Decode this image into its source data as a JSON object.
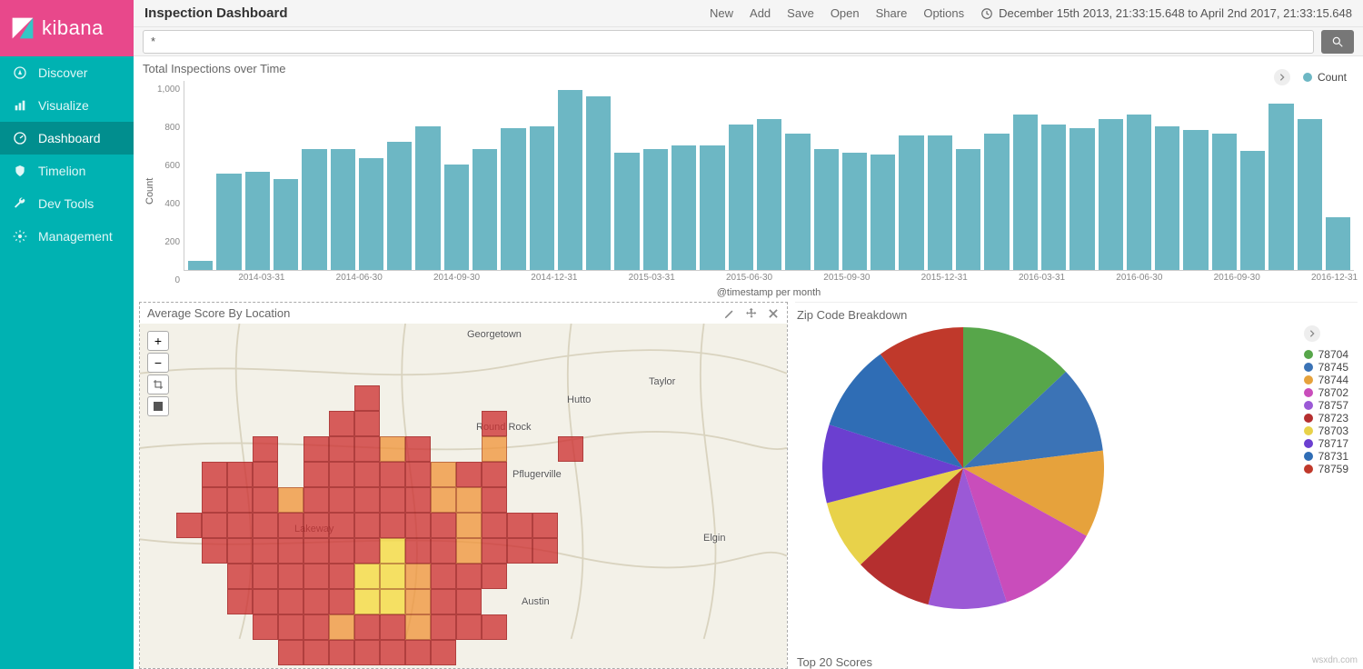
{
  "brand": "kibana",
  "sidebar": {
    "items": [
      {
        "label": "Discover"
      },
      {
        "label": "Visualize"
      },
      {
        "label": "Dashboard"
      },
      {
        "label": "Timelion"
      },
      {
        "label": "Dev Tools"
      },
      {
        "label": "Management"
      }
    ]
  },
  "topbar": {
    "title": "Inspection Dashboard",
    "links": [
      "New",
      "Add",
      "Save",
      "Open",
      "Share",
      "Options"
    ],
    "timerange": "December 15th 2013, 21:33:15.648 to April 2nd 2017, 21:33:15.648"
  },
  "search": {
    "value": "*"
  },
  "barpanel": {
    "title": "Total Inspections over Time",
    "ylabel": "Count",
    "xlabel": "@timestamp per month",
    "legend": "Count",
    "legend_color": "#6db7c4",
    "yticks": [
      "1,000",
      "800",
      "600",
      "400",
      "200",
      "0"
    ],
    "xticks": [
      "2014-03-31",
      "2014-06-30",
      "2014-09-30",
      "2014-12-31",
      "2015-03-31",
      "2015-06-30",
      "2015-09-30",
      "2015-12-31",
      "2016-03-31",
      "2016-06-30",
      "2016-09-30",
      "2016-12-31"
    ]
  },
  "chart_data": [
    {
      "id": "bar-total-inspections",
      "type": "bar",
      "title": "Total Inspections over Time",
      "xlabel": "@timestamp per month",
      "ylabel": "Count",
      "ylim": [
        0,
        1000
      ],
      "categories": [
        "2014-01",
        "2014-02",
        "2014-03",
        "2014-04",
        "2014-05",
        "2014-06",
        "2014-07",
        "2014-08",
        "2014-09",
        "2014-10",
        "2014-11",
        "2014-12",
        "2015-01",
        "2015-02",
        "2015-03",
        "2015-04",
        "2015-05",
        "2015-06",
        "2015-07",
        "2015-08",
        "2015-09",
        "2015-10",
        "2015-11",
        "2015-12",
        "2016-01",
        "2016-02",
        "2016-03",
        "2016-04",
        "2016-05",
        "2016-06",
        "2016-07",
        "2016-08",
        "2016-09",
        "2016-10",
        "2016-11",
        "2016-12",
        "2017-01",
        "2017-02",
        "2017-03"
      ],
      "series": [
        {
          "name": "Count",
          "color": "#6db7c4",
          "values": [
            50,
            510,
            520,
            480,
            640,
            640,
            590,
            680,
            760,
            560,
            640,
            750,
            760,
            950,
            920,
            620,
            640,
            660,
            660,
            770,
            800,
            720,
            640,
            620,
            610,
            710,
            710,
            640,
            720,
            820,
            770,
            750,
            800,
            820,
            760,
            740,
            720,
            630,
            880,
            800,
            280
          ]
        }
      ]
    },
    {
      "id": "pie-zip-breakdown",
      "type": "pie",
      "title": "Zip Code Breakdown",
      "series": [
        {
          "name": "Zip",
          "slices": [
            {
              "label": "78704",
              "value": 13,
              "color": "#57a64a"
            },
            {
              "label": "78745",
              "value": 10,
              "color": "#3b73b6"
            },
            {
              "label": "78744",
              "value": 10,
              "color": "#e6a23c"
            },
            {
              "label": "78702",
              "value": 12,
              "color": "#c94dbb"
            },
            {
              "label": "78757",
              "value": 9,
              "color": "#9b59d6"
            },
            {
              "label": "78723",
              "value": 9,
              "color": "#b52f2f"
            },
            {
              "label": "78703",
              "value": 8,
              "color": "#e8d24a"
            },
            {
              "label": "78717",
              "value": 9,
              "color": "#6b3fd0"
            },
            {
              "label": "78731",
              "value": 10,
              "color": "#2f6db5"
            },
            {
              "label": "78759",
              "value": 10,
              "color": "#c0392b"
            }
          ]
        }
      ]
    }
  ],
  "map": {
    "title": "Average Score By Location",
    "labels": [
      "Georgetown",
      "Round Rock",
      "Pflugerville",
      "Hutto",
      "Taylor",
      "Elgin",
      "Austin",
      "Lakeway"
    ]
  },
  "pie": {
    "title": "Zip Code Breakdown",
    "legend": [
      "78704",
      "78745",
      "78744",
      "78702",
      "78757",
      "78723",
      "78703",
      "78717",
      "78731",
      "78759"
    ],
    "colors": [
      "#57a64a",
      "#3b73b6",
      "#e6a23c",
      "#c94dbb",
      "#9b59d6",
      "#b52f2f",
      "#e8d24a",
      "#6b3fd0",
      "#2f6db5",
      "#c0392b"
    ]
  },
  "scores": {
    "title": "Top 20 Scores"
  },
  "watermark": "wsxdn.com"
}
